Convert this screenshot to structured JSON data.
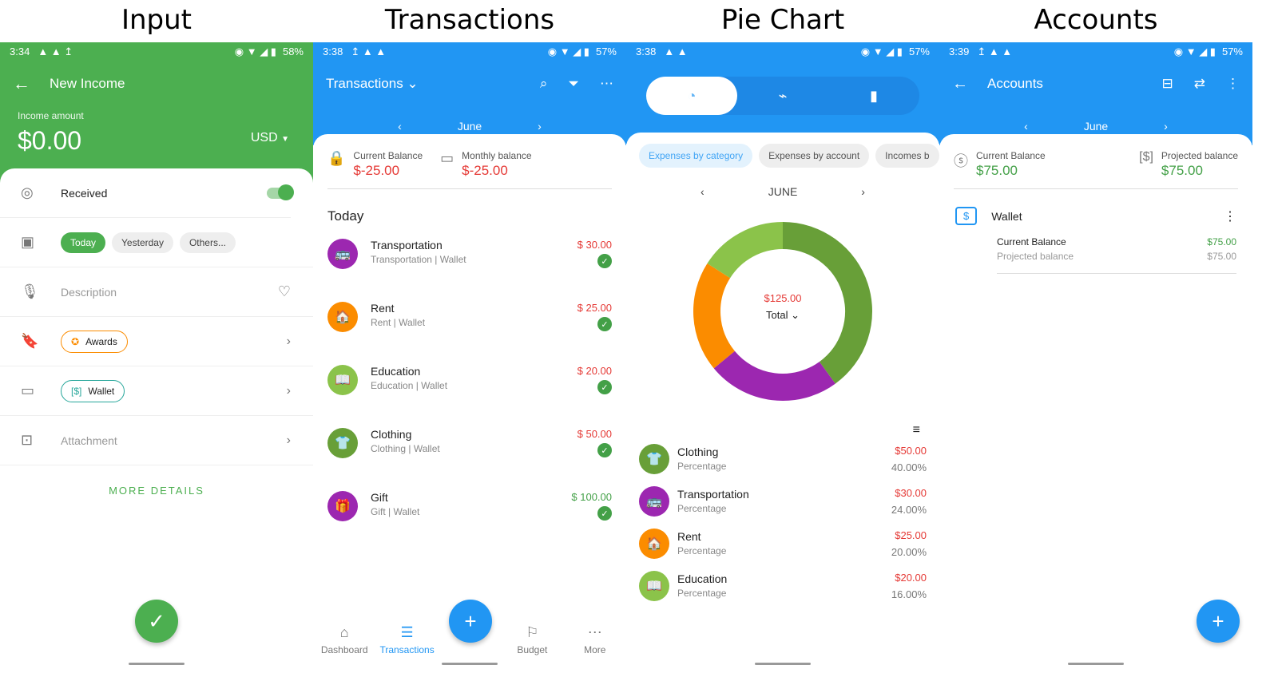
{
  "captions": [
    "Input",
    "Transactions",
    "Pie Chart",
    "Accounts"
  ],
  "input": {
    "status": {
      "time": "3:34",
      "battery": "58%"
    },
    "title": "New Income",
    "amount_label": "Income amount",
    "amount": "$0.00",
    "currency": "USD",
    "received_label": "Received",
    "date_chips": [
      "Today",
      "Yesterday",
      "Others..."
    ],
    "description_placeholder": "Description",
    "category": "Awards",
    "account": "Wallet",
    "attachment": "Attachment",
    "more_details": "MORE DETAILS"
  },
  "transactions": {
    "status": {
      "time": "3:38",
      "battery": "57%"
    },
    "title": "Transactions",
    "month": "June",
    "current_balance_label": "Current Balance",
    "current_balance": "$-25.00",
    "monthly_balance_label": "Monthly balance",
    "monthly_balance": "$-25.00",
    "section": "Today",
    "items": [
      {
        "name": "Transportation",
        "sub": "Transportation | Wallet",
        "amount": "$ 30.00",
        "color": "#9c27b0",
        "icon": "🚌",
        "type": "expense"
      },
      {
        "name": "Rent",
        "sub": "Rent | Wallet",
        "amount": "$ 25.00",
        "color": "#fb8c00",
        "icon": "🏠",
        "type": "expense"
      },
      {
        "name": "Education",
        "sub": "Education | Wallet",
        "amount": "$ 20.00",
        "color": "#8bc34a",
        "icon": "📖",
        "type": "expense"
      },
      {
        "name": "Clothing",
        "sub": "Clothing | Wallet",
        "amount": "$ 50.00",
        "color": "#689f38",
        "icon": "👕",
        "type": "expense"
      },
      {
        "name": "Gift",
        "sub": "Gift | Wallet",
        "amount": "$ 100.00",
        "color": "#9c27b0",
        "icon": "🎁",
        "type": "income"
      }
    ],
    "nav": [
      "Dashboard",
      "Transactions",
      "Budget",
      "More"
    ]
  },
  "pie": {
    "status": {
      "time": "3:38",
      "battery": "57%"
    },
    "filters": [
      "Expenses by category",
      "Expenses by account",
      "Incomes b"
    ],
    "month": "JUNE",
    "total_amount": "$125.00",
    "total_label": "Total",
    "items": [
      {
        "name": "Clothing",
        "sub": "Percentage",
        "amount": "$50.00",
        "percent": "40.00%",
        "color": "#689f38",
        "icon": "👕"
      },
      {
        "name": "Transportation",
        "sub": "Percentage",
        "amount": "$30.00",
        "percent": "24.00%",
        "color": "#9c27b0",
        "icon": "🚌"
      },
      {
        "name": "Rent",
        "sub": "Percentage",
        "amount": "$25.00",
        "percent": "20.00%",
        "color": "#fb8c00",
        "icon": "🏠"
      },
      {
        "name": "Education",
        "sub": "Percentage",
        "amount": "$20.00",
        "percent": "16.00%",
        "color": "#8bc34a",
        "icon": "📖"
      }
    ]
  },
  "accounts": {
    "status": {
      "time": "3:39",
      "battery": "57%"
    },
    "title": "Accounts",
    "month": "June",
    "current_balance_label": "Current Balance",
    "current_balance": "$75.00",
    "projected_balance_label": "Projected balance",
    "projected_balance": "$75.00",
    "wallet_name": "Wallet",
    "wallet_current_label": "Current Balance",
    "wallet_current": "$75.00",
    "wallet_projected_label": "Projected balance",
    "wallet_projected": "$75.00"
  }
}
